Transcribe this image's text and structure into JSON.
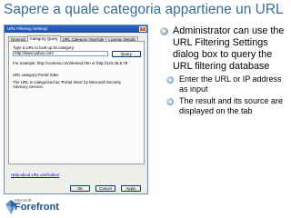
{
  "slide": {
    "title": "Sapere a quale categoria appartiene un URL"
  },
  "dialog": {
    "title": "URL Filtering Settings",
    "close_glyph": "×",
    "tabs": [
      {
        "label": "General"
      },
      {
        "label": "Category Query"
      },
      {
        "label": "URL Category Override"
      },
      {
        "label": "License Details"
      }
    ],
    "active_tab": "Category Query",
    "prompt_label": "Type a URL to look up its category:",
    "url_input_value": "http://www.yahoo.com",
    "query_label": "Query",
    "example_text": "For example: http://contoso.com/denied.htm or http://123.45.6.78",
    "category_label": "URL category:",
    "category_value": "Portal Sites",
    "result_line1": "The URL is categorized as 'Portal Sites' by Microsoft Security",
    "result_line2": "Advisory Service.",
    "help_link": "Help about URL verification",
    "ok_label": "OK",
    "cancel_label": "Cancel",
    "apply_label": "Apply"
  },
  "bullets": [
    {
      "text": "Administrator can use the URL Filtering Settings dialog box to query the URL filtering database",
      "icon": "bullet-icon"
    }
  ],
  "sub_bullets": [
    {
      "text": "Enter the URL or IP address as input",
      "icon": "bullet-icon"
    },
    {
      "text": "The result and its source are displayed on the tab",
      "icon": "bullet-icon"
    }
  ],
  "logo": {
    "company": "Microsoft",
    "product": "Forefront"
  },
  "colors": {
    "title": "#3a6a9a",
    "titlebar": "#2c63c8",
    "logo": "#1c4f95"
  }
}
